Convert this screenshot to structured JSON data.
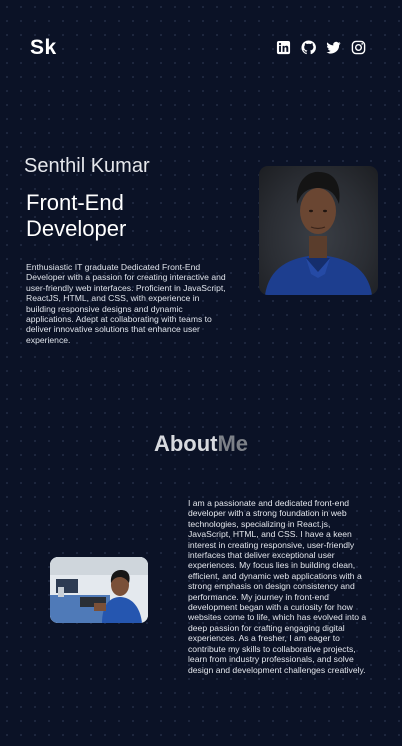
{
  "header": {
    "logo": "Sk",
    "social": [
      {
        "icon": "linkedin-icon"
      },
      {
        "icon": "github-icon"
      },
      {
        "icon": "twitter-icon"
      },
      {
        "icon": "instagram-icon"
      }
    ]
  },
  "hero": {
    "name": "Senthil Kumar",
    "role": "Front-End Developer",
    "intro": "Enthusiastic IT graduate Dedicated Front-End Developer with a passion for creating interactive and user-friendly web interfaces. Proficient in JavaScript, ReactJS, HTML, and CSS, with experience in building responsive designs and dynamic applications. Adept at collaborating with teams to deliver innovative solutions that enhance user experience."
  },
  "about": {
    "title_part1": "About",
    "title_part2": "Me",
    "text": "I am a passionate and dedicated front-end developer with a strong foundation in web technologies, specializing in React.js, JavaScript, HTML, and CSS. I have a keen interest in creating responsive, user-friendly interfaces that deliver exceptional user experiences. My focus lies in building clean, efficient, and dynamic web applications with a strong emphasis on design consistency and performance. My journey in front-end development began with a curiosity for how websites come to life, which has evolved into a deep passion for crafting engaging digital experiences. As a fresher, I am eager to contribute my skills to collaborative projects, learn from industry professionals, and solve design and development challenges creatively."
  },
  "colors": {
    "background": "#0b1226",
    "title_accent": "#7d8188"
  }
}
